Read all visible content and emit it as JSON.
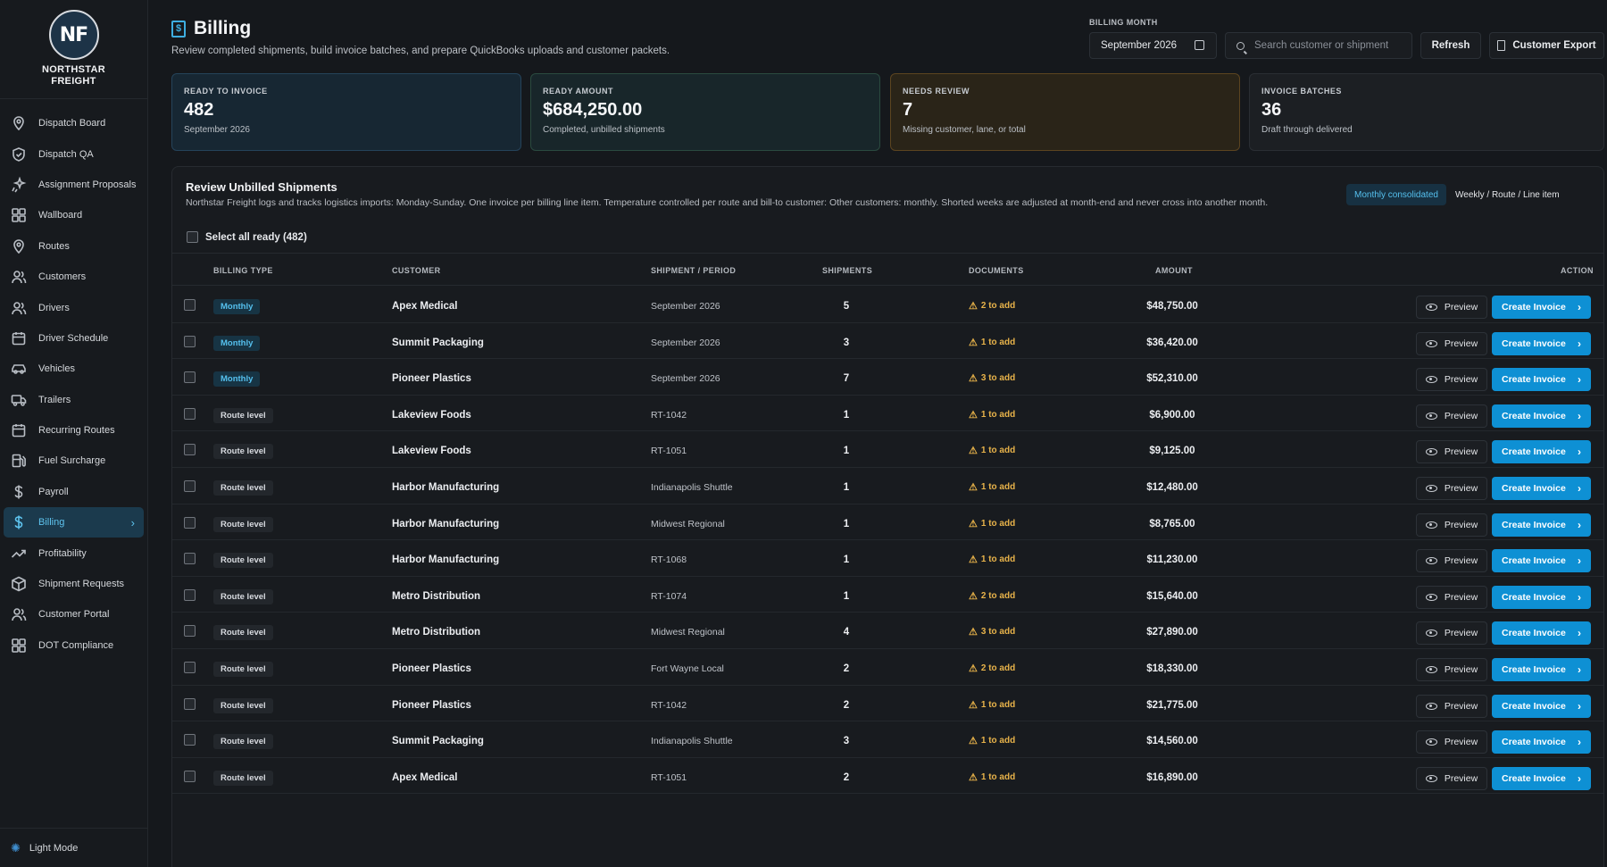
{
  "brand": {
    "initials": "NF",
    "name_line1": "NORTHSTAR",
    "name_line2": "FREIGHT"
  },
  "sidebar": {
    "items": [
      {
        "label": "Dispatch Board",
        "icon": "pin-icon"
      },
      {
        "label": "Dispatch QA",
        "icon": "shield-check-icon"
      },
      {
        "label": "Assignment Proposals",
        "icon": "sparkle-icon"
      },
      {
        "label": "Wallboard",
        "icon": "grid-icon"
      },
      {
        "label": "Routes",
        "icon": "pin-icon"
      },
      {
        "label": "Customers",
        "icon": "users-icon"
      },
      {
        "label": "Drivers",
        "icon": "users-icon"
      },
      {
        "label": "Driver Schedule",
        "icon": "calendar-icon"
      },
      {
        "label": "Vehicles",
        "icon": "car-icon"
      },
      {
        "label": "Trailers",
        "icon": "truck-icon"
      },
      {
        "label": "Recurring Routes",
        "icon": "calendar-icon"
      },
      {
        "label": "Fuel Surcharge",
        "icon": "fuel-icon"
      },
      {
        "label": "Payroll",
        "icon": "dollar-icon"
      },
      {
        "label": "Billing",
        "icon": "dollar-icon",
        "active": true
      },
      {
        "label": "Profitability",
        "icon": "trend-icon"
      },
      {
        "label": "Shipment Requests",
        "icon": "box-icon"
      },
      {
        "label": "Customer Portal",
        "icon": "users-icon"
      },
      {
        "label": "DOT Compliance",
        "icon": "grid-icon"
      }
    ],
    "footer": "Light Mode"
  },
  "header": {
    "title": "Billing",
    "subtitle": "Review completed shipments, build invoice batches, and prepare QuickBooks uploads and customer packets.",
    "billing_month_label": "BILLING MONTH",
    "billing_month": "September 2026",
    "search_placeholder": "Search customer or shipment",
    "refresh": "Refresh",
    "export": "Customer Export"
  },
  "kpis": [
    {
      "label": "READY TO INVOICE",
      "value": "482",
      "sub": "September 2026"
    },
    {
      "label": "READY AMOUNT",
      "value": "$684,250.00",
      "sub": "Completed, unbilled shipments"
    },
    {
      "label": "NEEDS REVIEW",
      "value": "7",
      "sub": "Missing customer, lane, or total"
    },
    {
      "label": "INVOICE BATCHES",
      "value": "36",
      "sub": "Draft through delivered"
    }
  ],
  "panel": {
    "title": "Review Unbilled Shipments",
    "description": "Northstar Freight logs and tracks logistics imports: Monday-Sunday. One invoice per billing line item. Temperature controlled per route and bill-to customer: Other customers: monthly. Shorted weeks are adjusted at month-end and never cross into another month.",
    "mode_active": "Monthly consolidated",
    "mode_other": "Weekly / Route / Line item",
    "select_all": "Select all ready (482)",
    "columns": [
      "BILLING TYPE",
      "CUSTOMER",
      "SHIPMENT / PERIOD",
      "SHIPMENTS",
      "DOCUMENTS",
      "AMOUNT",
      "ACTION"
    ],
    "preview_label": "Preview",
    "create_label": "Create Invoice",
    "rows": [
      {
        "type": "Monthly",
        "customer": "Apex Medical",
        "period": "September 2026",
        "shipments": "5",
        "docs": "2 to add",
        "amount": "$48,750.00"
      },
      {
        "type": "Monthly",
        "customer": "Summit Packaging",
        "period": "September 2026",
        "shipments": "3",
        "docs": "1 to add",
        "amount": "$36,420.00"
      },
      {
        "type": "Monthly",
        "customer": "Pioneer Plastics",
        "period": "September 2026",
        "shipments": "7",
        "docs": "3 to add",
        "amount": "$52,310.00"
      },
      {
        "type": "Route level",
        "customer": "Lakeview Foods",
        "period": "RT-1042",
        "shipments": "1",
        "docs": "1 to add",
        "amount": "$6,900.00"
      },
      {
        "type": "Route level",
        "customer": "Lakeview Foods",
        "period": "RT-1051",
        "shipments": "1",
        "docs": "1 to add",
        "amount": "$9,125.00"
      },
      {
        "type": "Route level",
        "customer": "Harbor Manufacturing",
        "period": "Indianapolis Shuttle",
        "shipments": "1",
        "docs": "1 to add",
        "amount": "$12,480.00"
      },
      {
        "type": "Route level",
        "customer": "Harbor Manufacturing",
        "period": "Midwest Regional",
        "shipments": "1",
        "docs": "1 to add",
        "amount": "$8,765.00"
      },
      {
        "type": "Route level",
        "customer": "Harbor Manufacturing",
        "period": "RT-1068",
        "shipments": "1",
        "docs": "1 to add",
        "amount": "$11,230.00"
      },
      {
        "type": "Route level",
        "customer": "Metro Distribution",
        "period": "RT-1074",
        "shipments": "1",
        "docs": "2 to add",
        "amount": "$15,640.00"
      },
      {
        "type": "Route level",
        "customer": "Metro Distribution",
        "period": "Midwest Regional",
        "shipments": "4",
        "docs": "3 to add",
        "amount": "$27,890.00"
      },
      {
        "type": "Route level",
        "customer": "Pioneer Plastics",
        "period": "Fort Wayne Local",
        "shipments": "2",
        "docs": "2 to add",
        "amount": "$18,330.00"
      },
      {
        "type": "Route level",
        "customer": "Pioneer Plastics",
        "period": "RT-1042",
        "shipments": "2",
        "docs": "1 to add",
        "amount": "$21,775.00"
      },
      {
        "type": "Route level",
        "customer": "Summit Packaging",
        "period": "Indianapolis Shuttle",
        "shipments": "3",
        "docs": "1 to add",
        "amount": "$14,560.00"
      },
      {
        "type": "Route level",
        "customer": "Apex Medical",
        "period": "RT-1051",
        "shipments": "2",
        "docs": "1 to add",
        "amount": "$16,890.00"
      }
    ]
  }
}
